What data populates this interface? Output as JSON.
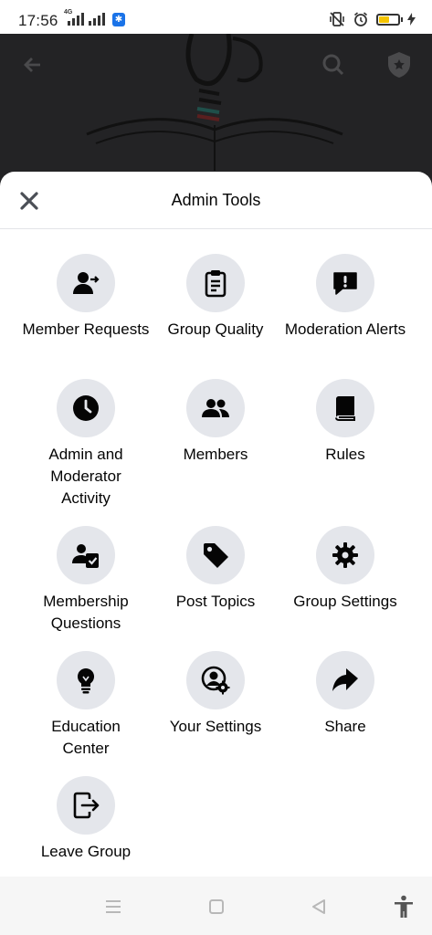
{
  "status_bar": {
    "time": "17:56",
    "network": "4G",
    "battery_color": "#f5c400"
  },
  "header": {
    "back_icon": "arrow-left-icon",
    "search_icon": "search-icon",
    "shield_icon": "admin-shield-icon"
  },
  "sheet": {
    "title": "Admin Tools",
    "close_icon": "close-icon"
  },
  "tools": [
    {
      "label": "Member Requests",
      "icon": "member-requests-icon"
    },
    {
      "label": "Group Quality",
      "icon": "clipboard-icon"
    },
    {
      "label": "Moderation Alerts",
      "icon": "alert-bubble-icon"
    },
    {
      "label": "Admin and Moderator Activity",
      "icon": "clock-icon"
    },
    {
      "label": "Members",
      "icon": "members-icon"
    },
    {
      "label": "Rules",
      "icon": "book-icon"
    },
    {
      "label": "Membership Questions",
      "icon": "membership-questions-icon"
    },
    {
      "label": "Post Topics",
      "icon": "tag-icon"
    },
    {
      "label": "Group Settings",
      "icon": "gear-icon"
    },
    {
      "label": "Education Center",
      "icon": "lightbulb-icon"
    },
    {
      "label": "Your Settings",
      "icon": "user-gear-icon"
    },
    {
      "label": "Share",
      "icon": "share-arrow-icon"
    },
    {
      "label": "Leave Group",
      "icon": "leave-icon"
    }
  ],
  "navbar": {
    "menu_icon": "menu-icon",
    "home_icon": "home-square-icon",
    "back_icon": "back-triangle-icon",
    "accessibility_icon": "accessibility-icon"
  }
}
